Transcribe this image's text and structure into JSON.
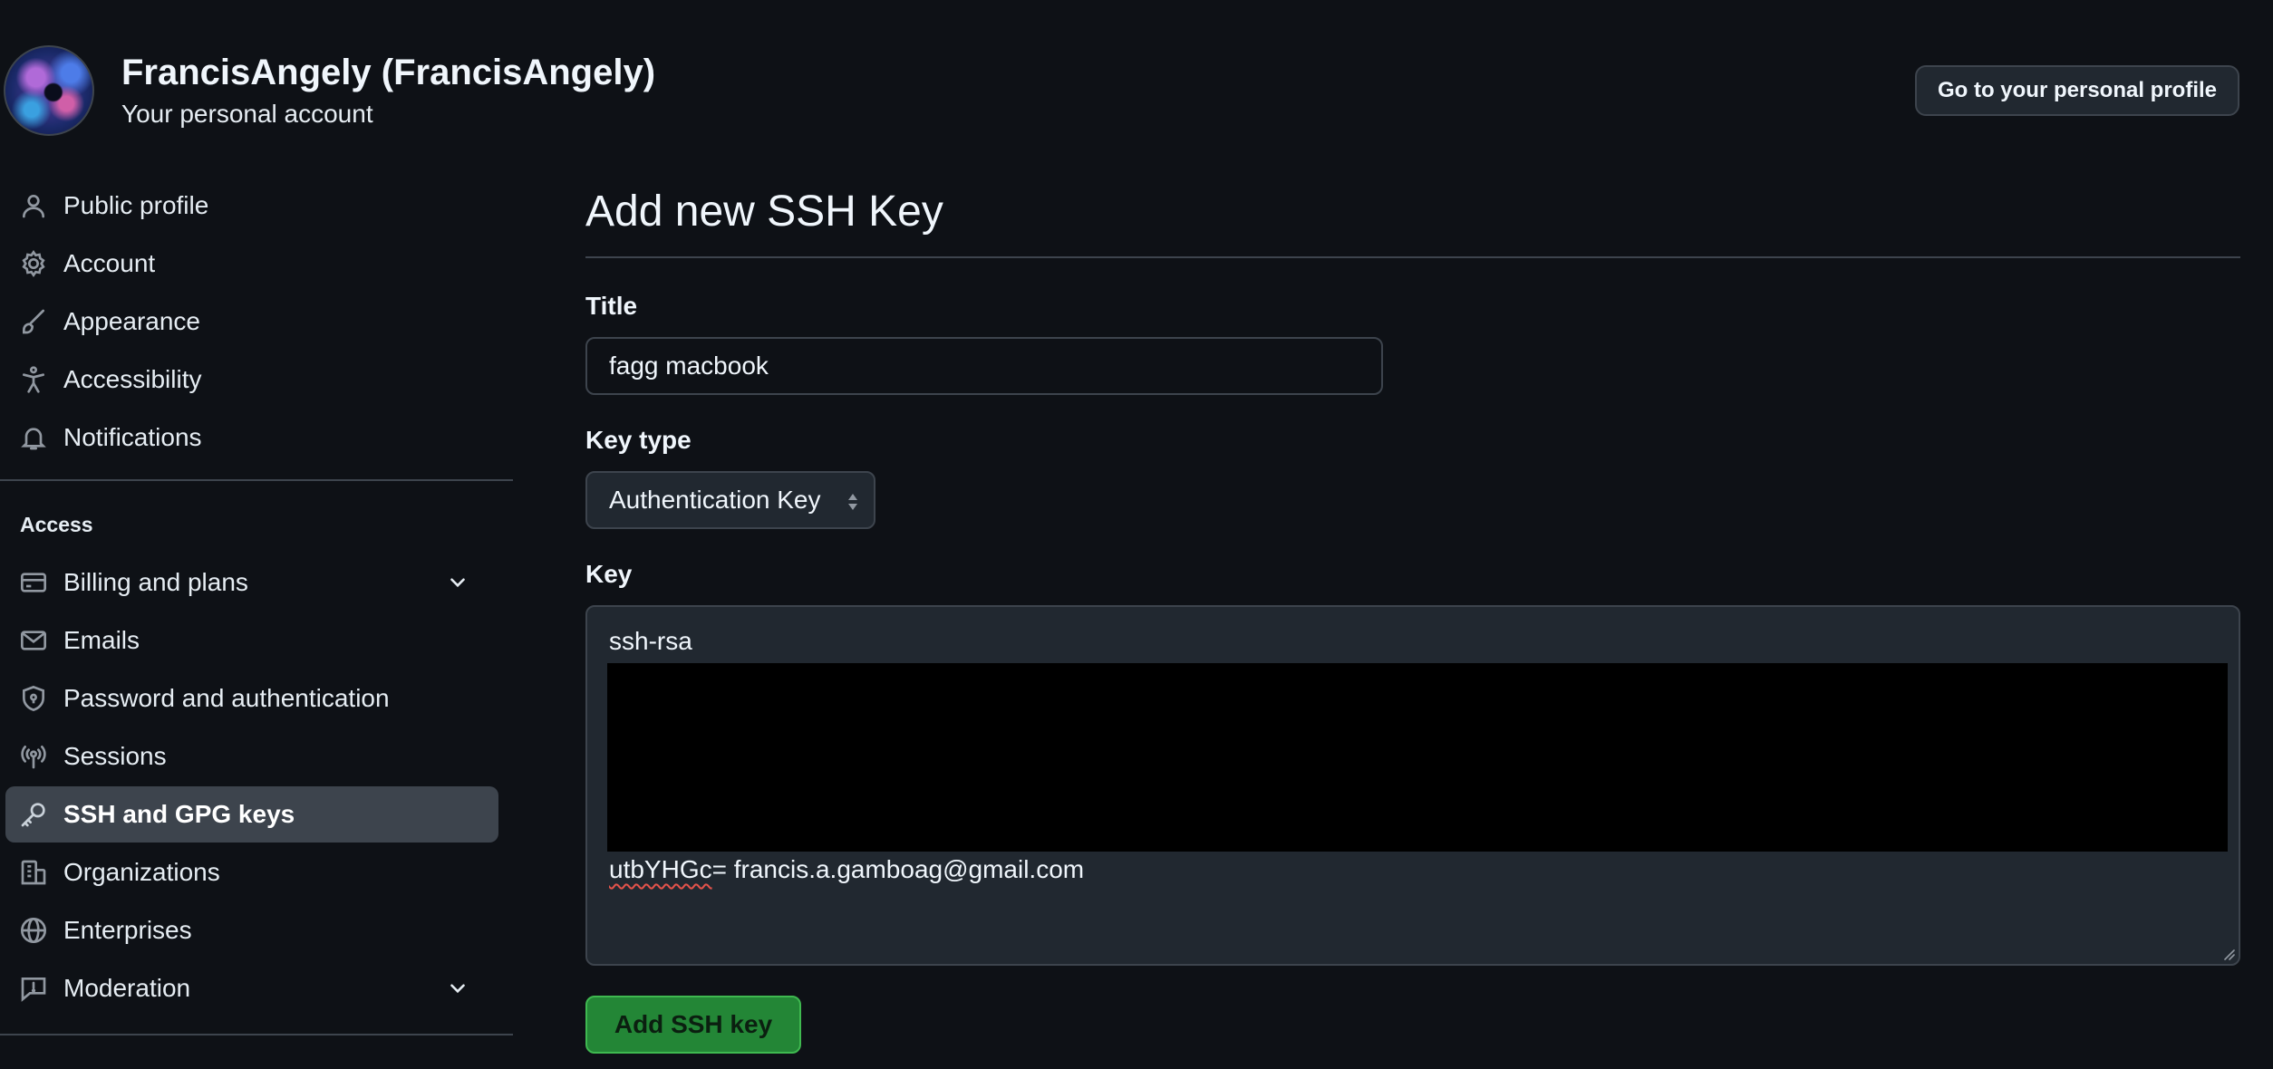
{
  "header": {
    "account_name": "FrancisAngely (FrancisAngely)",
    "account_subtitle": "Your personal account",
    "profile_button_label": "Go to your personal profile"
  },
  "sidebar": {
    "items": [
      {
        "label": "Public profile",
        "icon": "person-icon"
      },
      {
        "label": "Account",
        "icon": "gear-icon"
      },
      {
        "label": "Appearance",
        "icon": "paintbrush-icon"
      },
      {
        "label": "Accessibility",
        "icon": "accessibility-icon"
      },
      {
        "label": "Notifications",
        "icon": "bell-icon"
      }
    ],
    "access_section_label": "Access",
    "access_items": [
      {
        "label": "Billing and plans",
        "icon": "credit-card-icon",
        "expandable": true
      },
      {
        "label": "Emails",
        "icon": "mail-icon"
      },
      {
        "label": "Password and authentication",
        "icon": "shield-lock-icon"
      },
      {
        "label": "Sessions",
        "icon": "broadcast-icon"
      },
      {
        "label": "SSH and GPG keys",
        "icon": "key-icon",
        "active": true
      },
      {
        "label": "Organizations",
        "icon": "organization-icon"
      },
      {
        "label": "Enterprises",
        "icon": "globe-icon"
      },
      {
        "label": "Moderation",
        "icon": "report-icon",
        "expandable": true
      }
    ]
  },
  "main": {
    "title": "Add new SSH Key",
    "title_field": {
      "label": "Title",
      "value": "fagg macbook"
    },
    "key_type_field": {
      "label": "Key type",
      "selected": "Authentication Key"
    },
    "key_field": {
      "label": "Key",
      "line1": "ssh-rsa",
      "line2_misspelled": "utbYHGc",
      "line2_rest": "= francis.a.gamboag@gmail.com"
    },
    "submit_label": "Add SSH key"
  },
  "colors": {
    "background": "#0e1116",
    "border": "#3d444d",
    "active_nav": "#3d444d",
    "primary_button": "#238636"
  }
}
